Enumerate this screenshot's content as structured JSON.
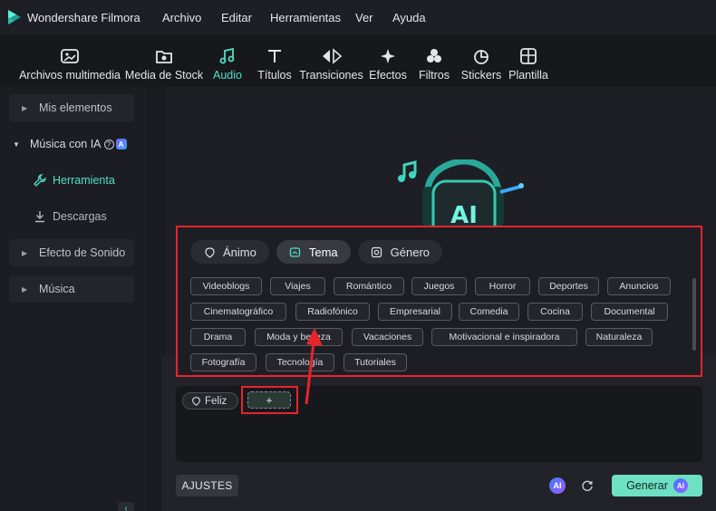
{
  "app": {
    "name": "Wondershare Filmora"
  },
  "menu": [
    "Archivo",
    "Editar",
    "Herramientas",
    "Ver",
    "Ayuda"
  ],
  "toolbar": [
    {
      "label": "Archivos multimedia",
      "icon": "media-icon"
    },
    {
      "label": "Media de Stock",
      "icon": "stock-media-icon"
    },
    {
      "label": "Audio",
      "icon": "music-note-icon",
      "active": true
    },
    {
      "label": "Títulos",
      "icon": "title-icon"
    },
    {
      "label": "Transiciones",
      "icon": "transition-icon"
    },
    {
      "label": "Efectos",
      "icon": "effects-icon"
    },
    {
      "label": "Filtros",
      "icon": "filters-icon"
    },
    {
      "label": "Stickers",
      "icon": "stickers-icon"
    },
    {
      "label": "Plantilla",
      "icon": "template-icon"
    }
  ],
  "sidebar": {
    "mis_elementos": "Mis elementos",
    "musica_ia": "Música con IA",
    "herramienta": "Herramienta",
    "descargas": "Descargas",
    "efecto_sonido": "Efecto de Sonido",
    "musica": "Música",
    "ai_badge": "A"
  },
  "hero": {
    "ai_text": "AI"
  },
  "tabs": [
    {
      "label": "Ánimo",
      "active": false
    },
    {
      "label": "Tema",
      "active": true
    },
    {
      "label": "Género",
      "active": false
    }
  ],
  "tags": [
    [
      "Videoblogs",
      "Viajes",
      "Romántico",
      "Juegos",
      "Horror",
      "Deportes",
      "Anuncios"
    ],
    [
      "Cinematográfico",
      "Radiofónico",
      "Empresarial",
      "Comedia",
      "Cocina",
      "Documental"
    ],
    [
      "Drama",
      "Moda y belleza",
      "Vacaciones",
      "Motivacional e inspiradora",
      "Naturaleza"
    ],
    [
      "Fotografía",
      "Tecnología",
      "Tutoriales"
    ]
  ],
  "prompt": {
    "chip": "Feliz",
    "add": "+"
  },
  "buttons": {
    "ajustes": "AJUSTES",
    "generar": "Generar",
    "ai": "AI"
  },
  "colors": {
    "accent": "#4fe0c6",
    "generate": "#6ee0c3",
    "highlight": "#e8242b"
  }
}
